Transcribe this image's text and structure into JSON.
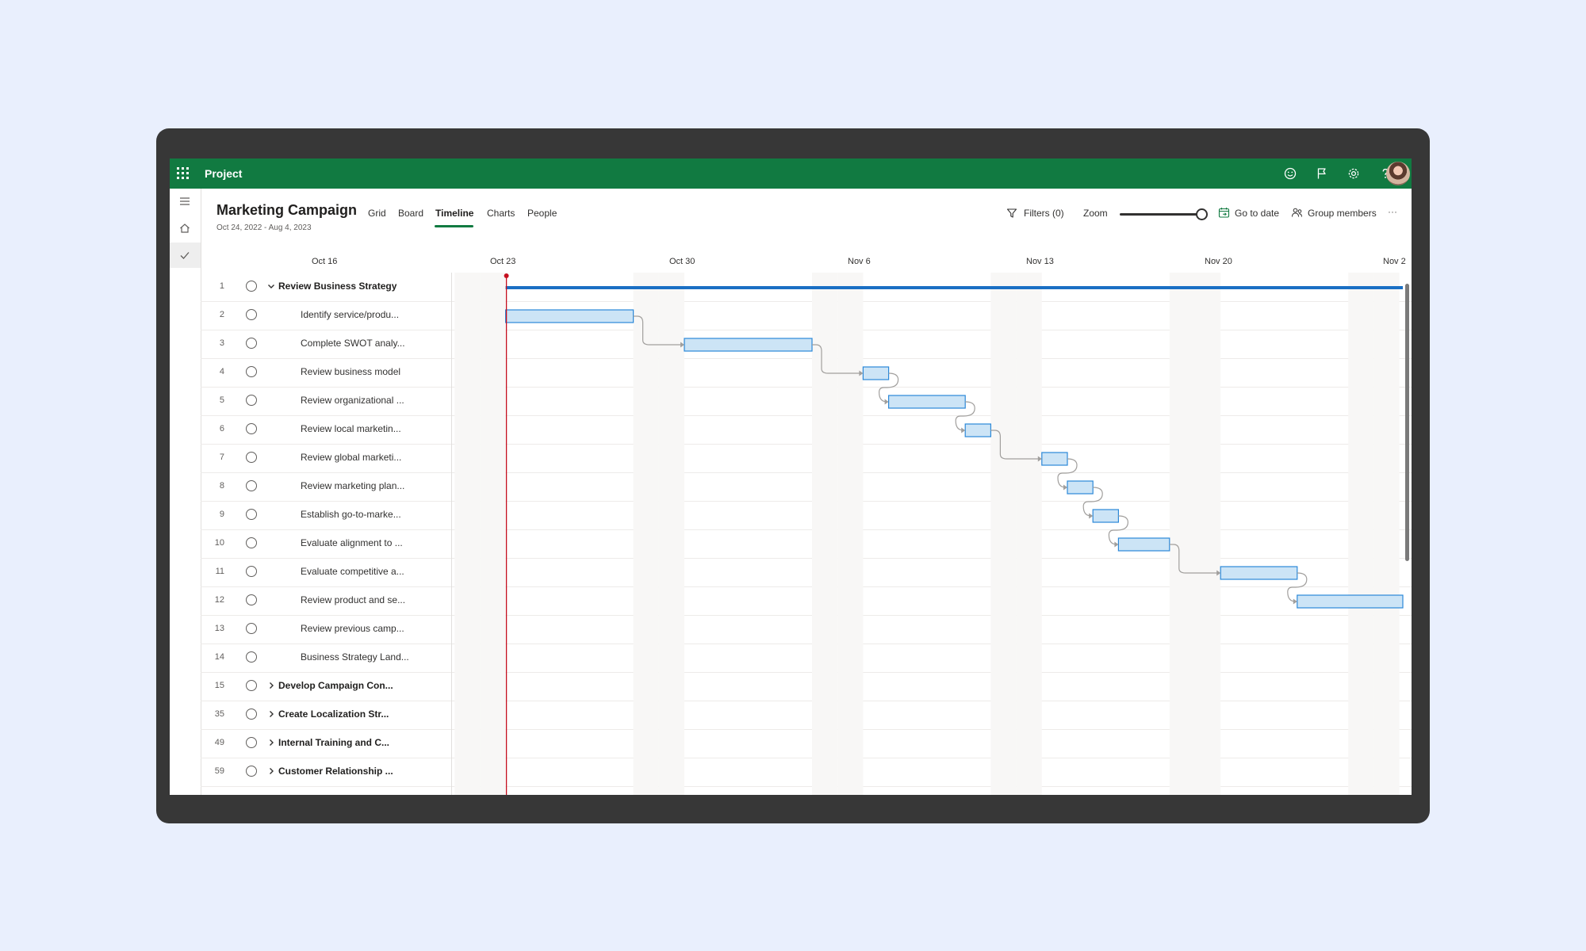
{
  "app": {
    "name": "Project"
  },
  "project": {
    "title": "Marketing Campaign",
    "dates": "Oct 24, 2022 - Aug 4, 2023"
  },
  "tabs": [
    {
      "label": "Grid",
      "active": false
    },
    {
      "label": "Board",
      "active": false
    },
    {
      "label": "Timeline",
      "active": true
    },
    {
      "label": "Charts",
      "active": false
    },
    {
      "label": "People",
      "active": false
    }
  ],
  "toolbar": {
    "filters": "Filters (0)",
    "zoom": "Zoom",
    "zoom_level": 1.0,
    "go_to_date": "Go to date",
    "group_members": "Group members",
    "more": "···"
  },
  "timeline": {
    "weeks": [
      "Oct 16",
      "Oct 23",
      "Oct 30",
      "Nov 6",
      "Nov 13",
      "Nov 20",
      "Nov 2"
    ],
    "today": "2022-10-24"
  },
  "tasks": [
    {
      "id": "1",
      "name": "Review Business Strategy",
      "summary": true,
      "expanded": true,
      "start": "2022-10-24",
      "end": "2022-12-31"
    },
    {
      "id": "2",
      "name": "Identify service/produ...",
      "summary": false,
      "start": "2022-10-24",
      "end": "2022-10-28"
    },
    {
      "id": "3",
      "name": "Complete SWOT analy...",
      "summary": false,
      "start": "2022-10-31",
      "end": "2022-11-04"
    },
    {
      "id": "4",
      "name": "Review business model",
      "summary": false,
      "start": "2022-11-07",
      "end": "2022-11-07"
    },
    {
      "id": "5",
      "name": "Review organizational ...",
      "summary": false,
      "start": "2022-11-08",
      "end": "2022-11-10"
    },
    {
      "id": "6",
      "name": "Review local marketin...",
      "summary": false,
      "start": "2022-11-11",
      "end": "2022-11-11"
    },
    {
      "id": "7",
      "name": "Review global marketi...",
      "summary": false,
      "start": "2022-11-14",
      "end": "2022-11-14"
    },
    {
      "id": "8",
      "name": "Review marketing plan...",
      "summary": false,
      "start": "2022-11-15",
      "end": "2022-11-15"
    },
    {
      "id": "9",
      "name": "Establish go-to-marke...",
      "summary": false,
      "start": "2022-11-16",
      "end": "2022-11-16"
    },
    {
      "id": "10",
      "name": "Evaluate alignment to ...",
      "summary": false,
      "start": "2022-11-17",
      "end": "2022-11-18"
    },
    {
      "id": "11",
      "name": "Evaluate competitive a...",
      "summary": false,
      "start": "2022-11-21",
      "end": "2022-11-23"
    },
    {
      "id": "12",
      "name": "Review product and se...",
      "summary": false,
      "start": "2022-11-24",
      "end": "2022-11-30"
    },
    {
      "id": "13",
      "name": "Review previous camp...",
      "summary": false
    },
    {
      "id": "14",
      "name": "Business Strategy Land...",
      "summary": false
    },
    {
      "id": "15",
      "name": "Develop Campaign Con...",
      "summary": true,
      "expanded": false
    },
    {
      "id": "35",
      "name": "Create Localization Str...",
      "summary": true,
      "expanded": false
    },
    {
      "id": "49",
      "name": "Internal Training and C...",
      "summary": true,
      "expanded": false
    },
    {
      "id": "59",
      "name": "Customer Relationship ...",
      "summary": true,
      "expanded": false
    }
  ],
  "colors": {
    "brand": "#117a41",
    "bar_fill": "#cce4f6",
    "bar_stroke": "#2b88d8",
    "summary_bar": "#1a6fc4",
    "today_line": "#c50f1f",
    "weekend": "#f8f7f6",
    "connector": "#a19f9d"
  }
}
